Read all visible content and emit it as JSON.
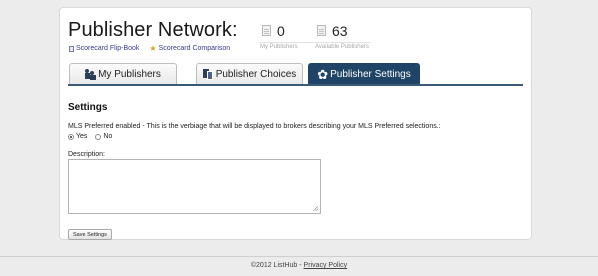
{
  "header": {
    "title": "Publisher Network:",
    "links": [
      {
        "label": "Scorecard Flip-Book",
        "icon": "document-icon"
      },
      {
        "label": "Scorecard Comparison",
        "icon": "star-icon"
      }
    ],
    "stats": [
      {
        "value": "0",
        "label": "My Publishers",
        "icon": "document-icon"
      },
      {
        "value": "63",
        "label": "Available Publishers",
        "icon": "document-icon"
      }
    ]
  },
  "tabs": [
    {
      "label": "My Publishers",
      "icon": "users-icon",
      "active": false
    },
    {
      "label": "Publisher Choices",
      "icon": "documents-icon",
      "active": false
    },
    {
      "label": "Publisher Settings",
      "icon": "gear-icon",
      "active": true
    }
  ],
  "settings": {
    "title": "Settings",
    "mls_label": "MLS Preferred enabled - This is the verbiage that will be displayed to brokers describing your MLS Preferred selections.:",
    "options": [
      {
        "label": "Yes",
        "checked": true
      },
      {
        "label": "No",
        "checked": false
      }
    ],
    "description_label": "Description:",
    "description_value": "",
    "save_label": "Save Settings"
  },
  "footer": {
    "copyright": "©2012 ListHub",
    "separator": " - ",
    "privacy_label": "Privacy Policy"
  },
  "colors": {
    "active_tab": "#1f4466",
    "tab_rule": "#3a5a78",
    "link": "#3b3b8f",
    "star": "#d9a227"
  }
}
